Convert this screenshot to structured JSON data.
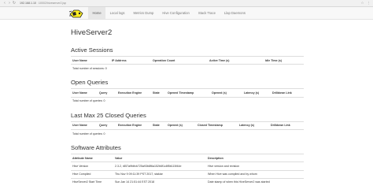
{
  "browser": {
    "address_host": "192.168.1.10",
    "address_path": ":10002/hiveserver2.jsp"
  },
  "nav": {
    "items": [
      {
        "label": "Home",
        "active": true
      },
      {
        "label": "Local logs",
        "active": false
      },
      {
        "label": "Metrics Dump",
        "active": false
      },
      {
        "label": "Hive Configuration",
        "active": false
      },
      {
        "label": "Stack Trace",
        "active": false
      },
      {
        "label": "Llap Daemons",
        "active": false
      }
    ]
  },
  "page_title": "HiveServer2",
  "active_sessions": {
    "title": "Active Sessions",
    "headers": [
      "User Name",
      "IP Address",
      "Operation Count",
      "Active Time (s)",
      "Idle Time (s)"
    ],
    "total": "Total number of sessions: 0"
  },
  "open_queries": {
    "title": "Open Queries",
    "headers": [
      "User Name",
      "Query",
      "Execution Engine",
      "State",
      "Opened Timestamp",
      "Opened (s)",
      "Latency (s)",
      "Drilldown Link"
    ],
    "total": "Total number of queries: 0"
  },
  "closed_queries": {
    "title": "Last Max 25 Closed Queries",
    "headers": [
      "User Name",
      "Query",
      "Execution Engine",
      "State",
      "Opened (s)",
      "Closed Timestamp",
      "Latency (s)",
      "Drilldown Link"
    ],
    "total": "Total number of queries: 0"
  },
  "software_attributes": {
    "title": "Software Attributes",
    "headers": [
      "Attribute Name",
      "Value",
      "Description"
    ],
    "rows": [
      [
        "Hive Version",
        "2.3.2, r857a9fdfcb725a93b8f6a152b6f1c8f5b115f44e",
        "Hive version and revision"
      ],
      [
        "Hive Compiled",
        "Thu Nov 9 09:11:39 PST 2017, stakiar",
        "When Hive was compiled and by whom"
      ],
      [
        "HiveServer2 Start Time",
        "Sun Jan 14 21:51:44 EST 2018",
        "Date stamp of when this HiveServer2 was started"
      ]
    ]
  }
}
